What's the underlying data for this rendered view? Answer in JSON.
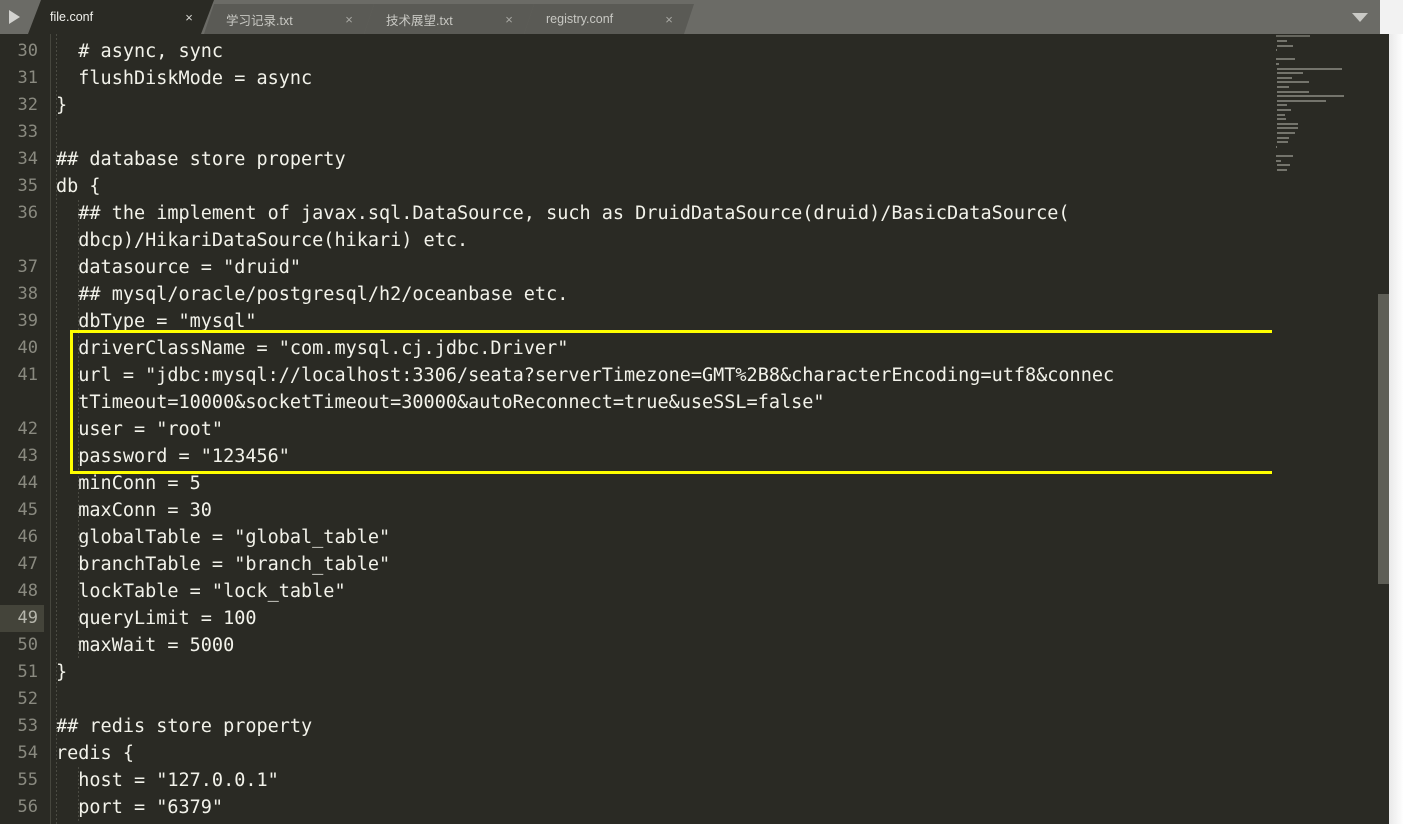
{
  "window": {
    "background_color": "#2a2a24",
    "text_color": "#f2f2ea"
  },
  "tabbar": {
    "background_color": "#6b6b66",
    "scroll_left_icon": "play-right-icon",
    "dropdown_icon": "chevron-down-icon",
    "close_glyph": "×",
    "tabs": [
      {
        "label": "file.conf",
        "active": true
      },
      {
        "label": "学习记录.txt",
        "active": false
      },
      {
        "label": "技术展望.txt",
        "active": false
      },
      {
        "label": "registry.conf",
        "active": false
      }
    ]
  },
  "editor": {
    "first_line_number": 30,
    "current_line": 49,
    "highlight_color": "#ffff00",
    "lines": [
      {
        "num": 30,
        "text": "  # async, sync"
      },
      {
        "num": 31,
        "text": "  flushDiskMode = async"
      },
      {
        "num": 32,
        "text": "}"
      },
      {
        "num": 33,
        "text": ""
      },
      {
        "num": 34,
        "text": "## database store property"
      },
      {
        "num": 35,
        "text": "db {"
      },
      {
        "num": 36,
        "text": "  ## the implement of javax.sql.DataSource, such as DruidDataSource(druid)/BasicDataSource("
      },
      {
        "num": "",
        "text": "  dbcp)/HikariDataSource(hikari) etc."
      },
      {
        "num": 37,
        "text": "  datasource = \"druid\""
      },
      {
        "num": 38,
        "text": "  ## mysql/oracle/postgresql/h2/oceanbase etc."
      },
      {
        "num": 39,
        "text": "  dbType = \"mysql\""
      },
      {
        "num": 40,
        "text": "  driverClassName = \"com.mysql.cj.jdbc.Driver\""
      },
      {
        "num": 41,
        "text": "  url = \"jdbc:mysql://localhost:3306/seata?serverTimezone=GMT%2B8&characterEncoding=utf8&connec"
      },
      {
        "num": "",
        "text": "  tTimeout=10000&socketTimeout=30000&autoReconnect=true&useSSL=false\""
      },
      {
        "num": 42,
        "text": "  user = \"root\""
      },
      {
        "num": 43,
        "text": "  password = \"123456\""
      },
      {
        "num": 44,
        "text": "  minConn = 5"
      },
      {
        "num": 45,
        "text": "  maxConn = 30"
      },
      {
        "num": 46,
        "text": "  globalTable = \"global_table\""
      },
      {
        "num": 47,
        "text": "  branchTable = \"branch_table\""
      },
      {
        "num": 48,
        "text": "  lockTable = \"lock_table\""
      },
      {
        "num": 49,
        "text": "  queryLimit = 100"
      },
      {
        "num": 50,
        "text": "  maxWait = 5000"
      },
      {
        "num": 51,
        "text": "}"
      },
      {
        "num": 52,
        "text": ""
      },
      {
        "num": 53,
        "text": "## redis store property"
      },
      {
        "num": 54,
        "text": "redis {"
      },
      {
        "num": 55,
        "text": "  host = \"127.0.0.1\""
      },
      {
        "num": 56,
        "text": "  port = \"6379\""
      }
    ]
  },
  "minimap": {
    "present": true
  },
  "scrollbar": {
    "orientation": "vertical"
  }
}
